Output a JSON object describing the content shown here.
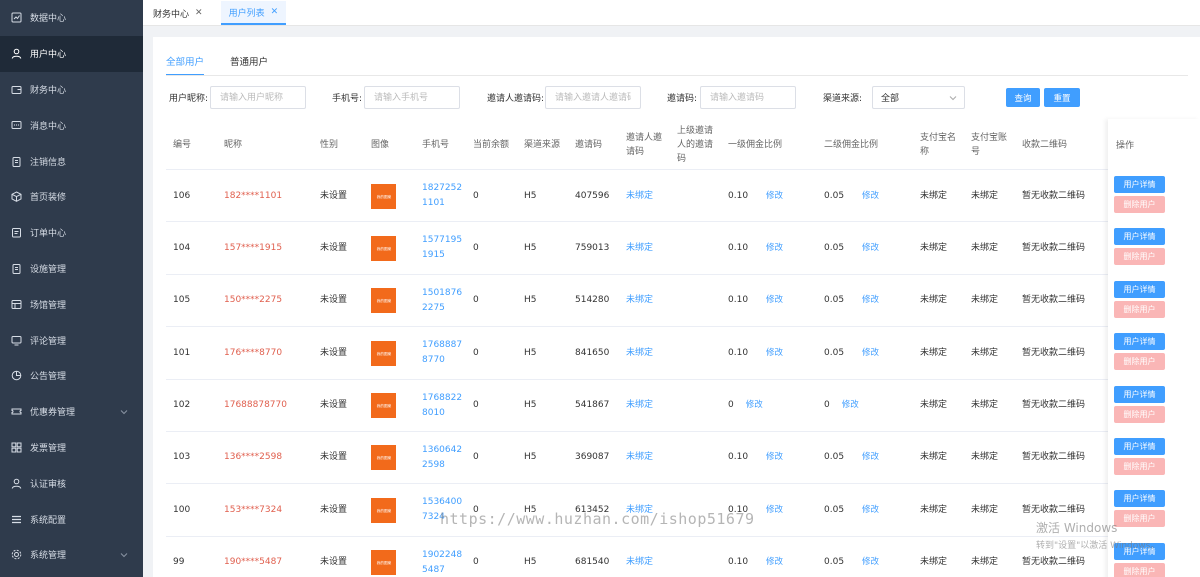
{
  "sidebar": {
    "items": [
      {
        "label": "数据中心",
        "icon": "chart-icon"
      },
      {
        "label": "用户中心",
        "icon": "user-icon",
        "active": true
      },
      {
        "label": "财务中心",
        "icon": "wallet-icon"
      },
      {
        "label": "消息中心",
        "icon": "message-icon"
      },
      {
        "label": "注销信息",
        "icon": "clipboard-icon"
      },
      {
        "label": "首页装修",
        "icon": "cube-icon"
      },
      {
        "label": "订单中心",
        "icon": "order-icon"
      },
      {
        "label": "设施管理",
        "icon": "clipboard-icon"
      },
      {
        "label": "场馆管理",
        "icon": "table-icon"
      },
      {
        "label": "评论管理",
        "icon": "monitor-icon"
      },
      {
        "label": "公告管理",
        "icon": "pie-icon"
      },
      {
        "label": "优惠券管理",
        "icon": "coupon-icon",
        "expandable": true
      },
      {
        "label": "发票管理",
        "icon": "grid-icon"
      },
      {
        "label": "认证审核",
        "icon": "user-icon"
      },
      {
        "label": "系统配置",
        "icon": "list-icon"
      },
      {
        "label": "系统管理",
        "icon": "settings-icon",
        "expandable": true
      }
    ]
  },
  "tabs": [
    {
      "label": "财务中心",
      "close": "✕"
    },
    {
      "label": "用户列表",
      "close": "✕",
      "active": true
    }
  ],
  "subtabs": [
    "全部用户",
    "普通用户"
  ],
  "filters": {
    "nickname_label": "用户昵称:",
    "nickname_placeholder": "请输入用户昵称",
    "phone_label": "手机号:",
    "phone_placeholder": "请输入手机号",
    "inviter_label": "邀请人邀请码:",
    "inviter_placeholder": "请输入邀请人邀请码",
    "code_label": "邀请码:",
    "code_placeholder": "请输入邀请码",
    "channel_label": "渠道来源:",
    "channel_value": "全部",
    "query_button": "查询",
    "reset_button": "重置"
  },
  "table": {
    "headers": {
      "id": "编号",
      "nickname": "昵称",
      "gender": "性别",
      "avatar": "图像",
      "phone": "手机号",
      "balance": "当前余额",
      "channel": "渠道来源",
      "invite_code": "邀请码",
      "inviter_code": "邀请人邀请码",
      "parent_code": "上级邀请人的邀请码",
      "commission1": "一级佣金比例",
      "commission2": "二级佣金比例",
      "alipay_name": "支付宝名称",
      "alipay_account": "支付宝账号",
      "qr": "收款二维码",
      "ops": "操作"
    },
    "edit_label": "修改",
    "detail_button": "用户详情",
    "delete_button": "删除用户",
    "avatar_text": "我的图案",
    "rows": [
      {
        "id": "106",
        "nickname": "182****1101",
        "gender": "未设置",
        "phone_l1": "1827252",
        "phone_l2": "1101",
        "balance": "0",
        "channel": "H5",
        "invite_code": "407596",
        "inviter": "未绑定",
        "parent": "",
        "c1": "0.10",
        "c2": "0.05",
        "alipay_name": "未绑定",
        "alipay_account": "未绑定",
        "qr": "暂无收款二维码"
      },
      {
        "id": "104",
        "nickname": "157****1915",
        "gender": "未设置",
        "phone_l1": "1577195",
        "phone_l2": "1915",
        "balance": "0",
        "channel": "H5",
        "invite_code": "759013",
        "inviter": "未绑定",
        "parent": "",
        "c1": "0.10",
        "c2": "0.05",
        "alipay_name": "未绑定",
        "alipay_account": "未绑定",
        "qr": "暂无收款二维码"
      },
      {
        "id": "105",
        "nickname": "150****2275",
        "gender": "未设置",
        "phone_l1": "1501876",
        "phone_l2": "2275",
        "balance": "0",
        "channel": "H5",
        "invite_code": "514280",
        "inviter": "未绑定",
        "parent": "",
        "c1": "0.10",
        "c2": "0.05",
        "alipay_name": "未绑定",
        "alipay_account": "未绑定",
        "qr": "暂无收款二维码"
      },
      {
        "id": "101",
        "nickname": "176****8770",
        "gender": "未设置",
        "phone_l1": "1768887",
        "phone_l2": "8770",
        "balance": "0",
        "channel": "H5",
        "invite_code": "841650",
        "inviter": "未绑定",
        "parent": "",
        "c1": "0.10",
        "c2": "0.05",
        "alipay_name": "未绑定",
        "alipay_account": "未绑定",
        "qr": "暂无收款二维码"
      },
      {
        "id": "102",
        "nickname": "17688878770",
        "gender": "未设置",
        "phone_l1": "1768822",
        "phone_l2": "8010",
        "balance": "0",
        "channel": "H5",
        "invite_code": "541867",
        "inviter": "未绑定",
        "parent": "",
        "c1": "0",
        "c2": "0",
        "alipay_name": "未绑定",
        "alipay_account": "未绑定",
        "qr": "暂无收款二维码"
      },
      {
        "id": "103",
        "nickname": "136****2598",
        "gender": "未设置",
        "phone_l1": "1360642",
        "phone_l2": "2598",
        "balance": "0",
        "channel": "H5",
        "invite_code": "369087",
        "inviter": "未绑定",
        "parent": "",
        "c1": "0.10",
        "c2": "0.05",
        "alipay_name": "未绑定",
        "alipay_account": "未绑定",
        "qr": "暂无收款二维码"
      },
      {
        "id": "100",
        "nickname": "153****7324",
        "gender": "未设置",
        "phone_l1": "1536400",
        "phone_l2": "7324",
        "balance": "0",
        "channel": "H5",
        "invite_code": "613452",
        "inviter": "未绑定",
        "parent": "",
        "c1": "0.10",
        "c2": "0.05",
        "alipay_name": "未绑定",
        "alipay_account": "未绑定",
        "qr": "暂无收款二维码"
      },
      {
        "id": "99",
        "nickname": "190****5487",
        "gender": "未设置",
        "phone_l1": "1902248",
        "phone_l2": "5487",
        "balance": "0",
        "channel": "H5",
        "invite_code": "681540",
        "inviter": "未绑定",
        "parent": "",
        "c1": "0.10",
        "c2": "0.05",
        "alipay_name": "未绑定",
        "alipay_account": "未绑定",
        "qr": "暂无收款二维码"
      }
    ]
  },
  "watermark": "https://www.huzhan.com/ishop51679",
  "windows_activation": {
    "line1": "激活 Windows",
    "line2": "转到\"设置\"以激活 Windows。"
  }
}
